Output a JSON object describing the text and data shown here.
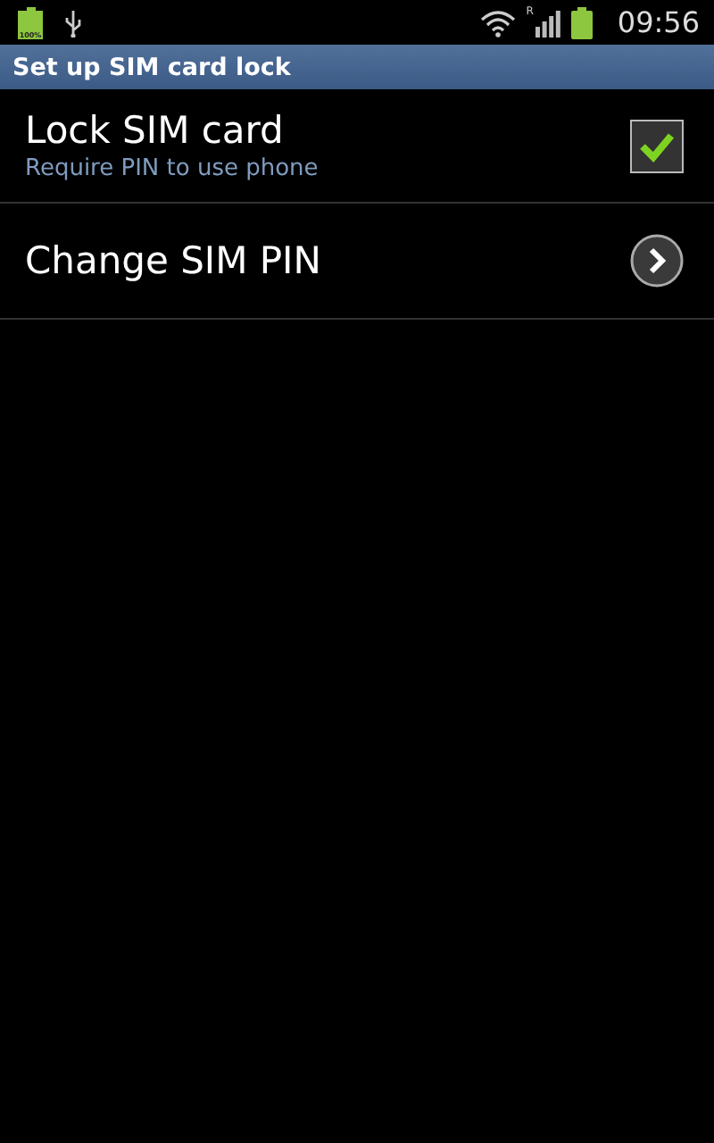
{
  "status_bar": {
    "battery_notification_text": "100%",
    "roaming_mark": "R",
    "time": "09:56"
  },
  "title_bar": {
    "title": "Set up SIM card lock"
  },
  "items": [
    {
      "kind": "checkbox",
      "title": "Lock SIM card",
      "summary": "Require PIN to use phone",
      "checked": true
    },
    {
      "kind": "link",
      "title": "Change SIM PIN"
    }
  ]
}
